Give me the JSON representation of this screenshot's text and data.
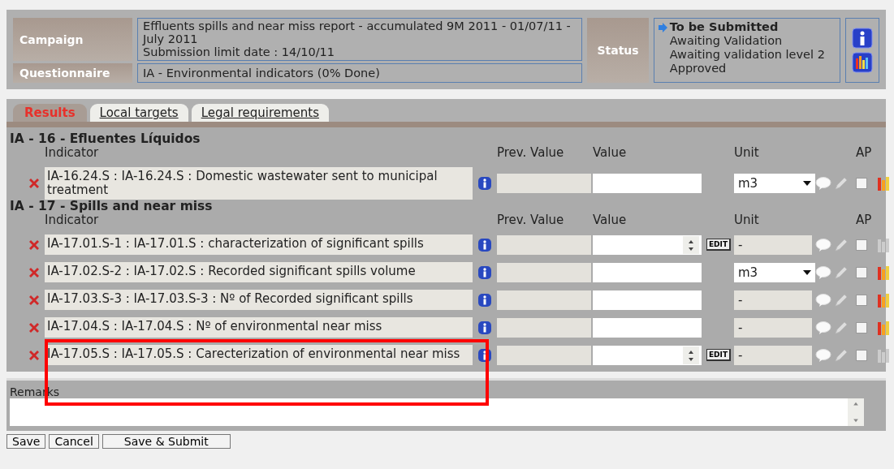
{
  "header": {
    "campaign_label": "Campaign",
    "campaign": "Effluents spills and near miss report - accumulated 9M 2011 - 01/07/11 - July 2011",
    "limit_date": "Submission limit date : 14/10/11",
    "questionnaire_label": "Questionnaire",
    "questionnaire": "IA - Environmental indicators (0% Done)",
    "status_label": "Status",
    "statuses": [
      {
        "label": "To be Submitted",
        "selected": true
      },
      {
        "label": "Awaiting Validation",
        "selected": false
      },
      {
        "label": "Awaiting validation level 2",
        "selected": false
      },
      {
        "label": "Approved",
        "selected": false
      }
    ]
  },
  "tabs": [
    {
      "label": "Results",
      "selected": true
    },
    {
      "label": "Local targets",
      "selected": false
    },
    {
      "label": "Legal requirements",
      "selected": false
    }
  ],
  "sections": [
    {
      "title": "IA - 16 - Efluentes Líquidos",
      "columns": {
        "indicator": "Indicator",
        "prev_value": "Prev. Value",
        "value": "Value",
        "unit": "Unit",
        "ap": "AP"
      },
      "rows": [
        {
          "indicator": "IA-16.24.S : IA-16.24.S : Domestic wastewater sent to municipal treatment",
          "value_field": {
            "kind": "text"
          },
          "unit_field": {
            "kind": "select",
            "value": "m3"
          },
          "ap_checked": false,
          "chart_enabled": true
        }
      ]
    },
    {
      "title": "IA - 17 - Spills and near miss",
      "columns": {
        "indicator": "Indicator",
        "prev_value": "Prev. Value",
        "value": "Value",
        "unit": "Unit",
        "ap": "AP"
      },
      "rows": [
        {
          "indicator": "IA-17.01.S-1 : IA-17.01.S : characterization of significant spills",
          "value_field": {
            "kind": "spinner"
          },
          "edit_button": "EDIT",
          "unit_field": {
            "kind": "text",
            "value": "-"
          },
          "ap_checked": false,
          "chart_enabled": false
        },
        {
          "indicator": "IA-17.02.S-2 : IA-17.02.S : Recorded significant spills volume",
          "value_field": {
            "kind": "text"
          },
          "unit_field": {
            "kind": "select",
            "value": "m3"
          },
          "ap_checked": false,
          "chart_enabled": true
        },
        {
          "indicator": "IA-17.03.S-3 : IA-17.03.S-3 : Nº of Recorded significant spills",
          "value_field": {
            "kind": "text"
          },
          "unit_field": {
            "kind": "text",
            "value": "-"
          },
          "ap_checked": false,
          "chart_enabled": true
        },
        {
          "indicator": "IA-17.04.S : IA-17.04.S : Nº of environmental near miss",
          "value_field": {
            "kind": "text"
          },
          "unit_field": {
            "kind": "text",
            "value": "-"
          },
          "ap_checked": false,
          "chart_enabled": true
        },
        {
          "indicator": "IA-17.05.S : IA-17.05.S : Carecterization of environmental near miss",
          "value_field": {
            "kind": "spinner"
          },
          "edit_button": "EDIT",
          "unit_field": {
            "kind": "text",
            "value": "-"
          },
          "ap_checked": false,
          "chart_enabled": false
        }
      ]
    }
  ],
  "remarks": {
    "label": "Remarks"
  },
  "buttons": [
    "Save",
    "Cancel",
    "Save & Submit"
  ]
}
